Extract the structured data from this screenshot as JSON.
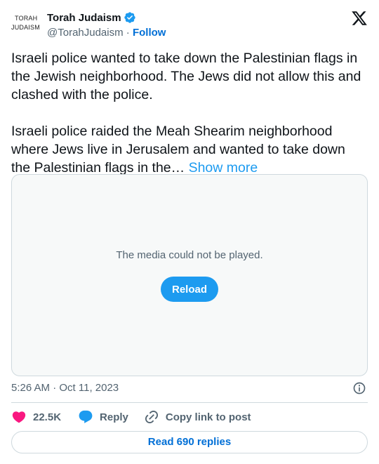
{
  "author": {
    "avatar_line1": "TORAH",
    "avatar_line2": "JUDAISM",
    "display_name": "Torah Judaism",
    "handle": "@TorahJudaism",
    "separator": "·",
    "follow_label": "Follow",
    "verified_icon": "verified-badge-icon",
    "verified_color": "#1d9bf0"
  },
  "platform_icon": "x-logo-icon",
  "tweet": {
    "paragraph1": "Israeli police wanted to take down the Palestinian flags in the Jewish neighborhood. The Jews did not allow this and clashed with the police.",
    "paragraph2": "Israeli police raided the Meah Shearim neighborhood where Jews live in Jerusalem and wanted to take down the Palestinian flags in the…",
    "show_more": "Show more"
  },
  "media": {
    "message": "The media could not be played.",
    "reload_label": "Reload"
  },
  "timestamp": "5:26 AM · Oct 11, 2023",
  "actions": {
    "likes": "22.5K",
    "reply_label": "Reply",
    "copy_label": "Copy link to post"
  },
  "read_replies_label": "Read 690 replies",
  "colors": {
    "accent": "#1d9bf0",
    "link": "#006fd6",
    "like": "#f91880",
    "muted": "#536471",
    "border": "#cfd9de"
  }
}
